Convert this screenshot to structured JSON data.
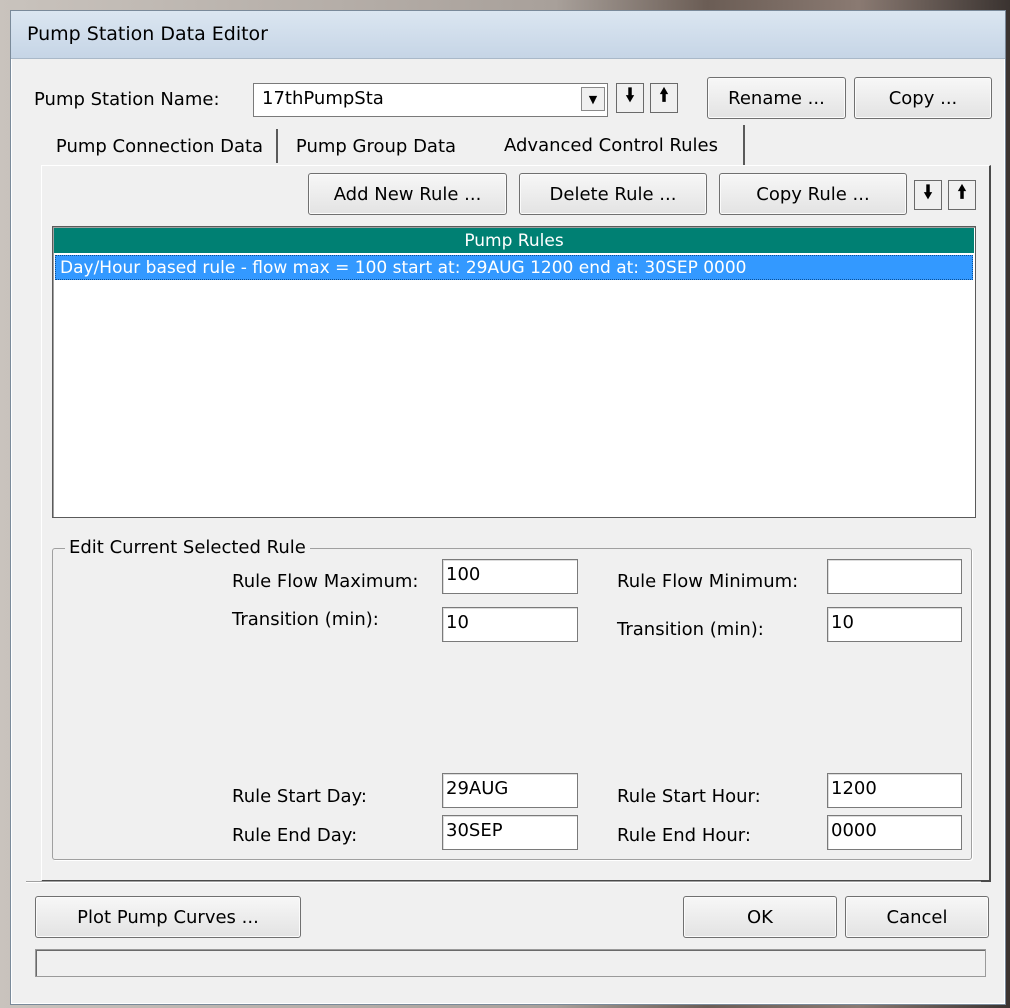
{
  "window": {
    "title": "Pump Station Data Editor"
  },
  "station": {
    "name_label": "Pump Station Name:",
    "name_value": "17thPumpSta",
    "rename_label": "Rename ...",
    "copy_label": "Copy ..."
  },
  "tabs": [
    {
      "label": "Pump Connection Data"
    },
    {
      "label": "Pump Group Data"
    },
    {
      "label": "Advanced Control Rules"
    }
  ],
  "rules_toolbar": {
    "add_label": "Add New Rule ...",
    "delete_label": "Delete Rule ...",
    "copy_label": "Copy Rule ..."
  },
  "rules_list": {
    "header": "Pump Rules",
    "items": [
      {
        "text": "Day/Hour based rule - flow max = 100 start at: 29AUG 1200 end at: 30SEP 0000",
        "selected": true
      }
    ]
  },
  "edit_rule": {
    "group_label": "Edit Current Selected Rule",
    "flow_max_label": "Rule Flow Maximum:",
    "flow_max_value": "100",
    "flow_min_label": "Rule Flow Minimum:",
    "flow_min_value": "",
    "transition_left_label": "Transition (min):",
    "transition_left_value": "10",
    "transition_right_label": "Transition (min):",
    "transition_right_value": "10",
    "start_day_label": "Rule Start Day:",
    "start_day_value": "29AUG",
    "start_hour_label": "Rule Start Hour:",
    "start_hour_value": "1200",
    "end_day_label": "Rule End Day:",
    "end_day_value": "30SEP",
    "end_hour_label": "Rule End Hour:",
    "end_hour_value": "0000"
  },
  "footer": {
    "plot_label": "Plot Pump Curves ...",
    "ok_label": "OK",
    "cancel_label": "Cancel",
    "status_text": ""
  },
  "icons": {
    "move_down": "arrow-down-icon",
    "move_up": "arrow-up-icon",
    "dropdown": "chevron-down-icon"
  },
  "colors": {
    "list_header": "#008073",
    "selection": "#3399ff"
  }
}
